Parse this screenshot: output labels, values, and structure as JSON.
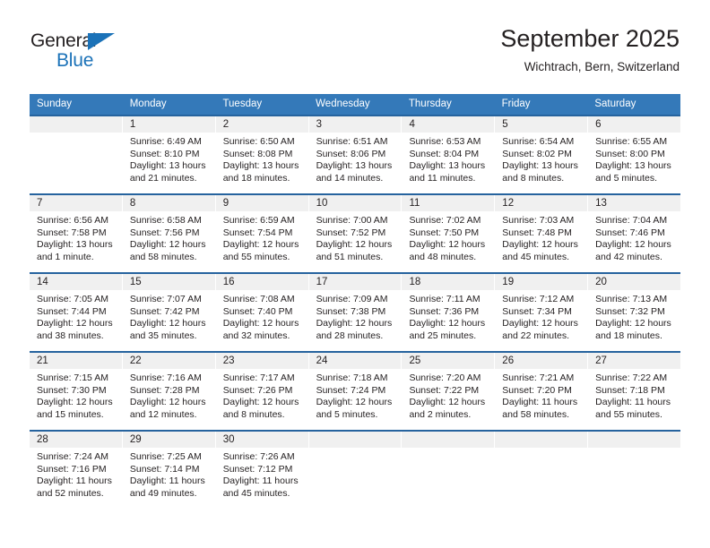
{
  "logo": {
    "word_top": "General",
    "word_bottom": "Blue",
    "triangle_color": "#1b72b8",
    "icon": "triangle-icon"
  },
  "header": {
    "title": "September 2025",
    "subtitle": "Wichtrach, Bern, Switzerland"
  },
  "theme": {
    "header_row_bg": "#3479b9",
    "week_divider": "#26639e",
    "daynum_band_bg": "#f0f0f0",
    "text": "#231f20"
  },
  "calendar": {
    "weekdays": [
      "Sunday",
      "Monday",
      "Tuesday",
      "Wednesday",
      "Thursday",
      "Friday",
      "Saturday"
    ],
    "weeks": [
      [
        {
          "day": "",
          "empty": true,
          "sunrise": "",
          "sunset": "",
          "daylight_line1": "",
          "daylight_line2": ""
        },
        {
          "day": "1",
          "sunrise": "Sunrise: 6:49 AM",
          "sunset": "Sunset: 8:10 PM",
          "daylight_line1": "Daylight: 13 hours",
          "daylight_line2": "and 21 minutes."
        },
        {
          "day": "2",
          "sunrise": "Sunrise: 6:50 AM",
          "sunset": "Sunset: 8:08 PM",
          "daylight_line1": "Daylight: 13 hours",
          "daylight_line2": "and 18 minutes."
        },
        {
          "day": "3",
          "sunrise": "Sunrise: 6:51 AM",
          "sunset": "Sunset: 8:06 PM",
          "daylight_line1": "Daylight: 13 hours",
          "daylight_line2": "and 14 minutes."
        },
        {
          "day": "4",
          "sunrise": "Sunrise: 6:53 AM",
          "sunset": "Sunset: 8:04 PM",
          "daylight_line1": "Daylight: 13 hours",
          "daylight_line2": "and 11 minutes."
        },
        {
          "day": "5",
          "sunrise": "Sunrise: 6:54 AM",
          "sunset": "Sunset: 8:02 PM",
          "daylight_line1": "Daylight: 13 hours",
          "daylight_line2": "and 8 minutes."
        },
        {
          "day": "6",
          "sunrise": "Sunrise: 6:55 AM",
          "sunset": "Sunset: 8:00 PM",
          "daylight_line1": "Daylight: 13 hours",
          "daylight_line2": "and 5 minutes."
        }
      ],
      [
        {
          "day": "7",
          "sunrise": "Sunrise: 6:56 AM",
          "sunset": "Sunset: 7:58 PM",
          "daylight_line1": "Daylight: 13 hours",
          "daylight_line2": "and 1 minute."
        },
        {
          "day": "8",
          "sunrise": "Sunrise: 6:58 AM",
          "sunset": "Sunset: 7:56 PM",
          "daylight_line1": "Daylight: 12 hours",
          "daylight_line2": "and 58 minutes."
        },
        {
          "day": "9",
          "sunrise": "Sunrise: 6:59 AM",
          "sunset": "Sunset: 7:54 PM",
          "daylight_line1": "Daylight: 12 hours",
          "daylight_line2": "and 55 minutes."
        },
        {
          "day": "10",
          "sunrise": "Sunrise: 7:00 AM",
          "sunset": "Sunset: 7:52 PM",
          "daylight_line1": "Daylight: 12 hours",
          "daylight_line2": "and 51 minutes."
        },
        {
          "day": "11",
          "sunrise": "Sunrise: 7:02 AM",
          "sunset": "Sunset: 7:50 PM",
          "daylight_line1": "Daylight: 12 hours",
          "daylight_line2": "and 48 minutes."
        },
        {
          "day": "12",
          "sunrise": "Sunrise: 7:03 AM",
          "sunset": "Sunset: 7:48 PM",
          "daylight_line1": "Daylight: 12 hours",
          "daylight_line2": "and 45 minutes."
        },
        {
          "day": "13",
          "sunrise": "Sunrise: 7:04 AM",
          "sunset": "Sunset: 7:46 PM",
          "daylight_line1": "Daylight: 12 hours",
          "daylight_line2": "and 42 minutes."
        }
      ],
      [
        {
          "day": "14",
          "sunrise": "Sunrise: 7:05 AM",
          "sunset": "Sunset: 7:44 PM",
          "daylight_line1": "Daylight: 12 hours",
          "daylight_line2": "and 38 minutes."
        },
        {
          "day": "15",
          "sunrise": "Sunrise: 7:07 AM",
          "sunset": "Sunset: 7:42 PM",
          "daylight_line1": "Daylight: 12 hours",
          "daylight_line2": "and 35 minutes."
        },
        {
          "day": "16",
          "sunrise": "Sunrise: 7:08 AM",
          "sunset": "Sunset: 7:40 PM",
          "daylight_line1": "Daylight: 12 hours",
          "daylight_line2": "and 32 minutes."
        },
        {
          "day": "17",
          "sunrise": "Sunrise: 7:09 AM",
          "sunset": "Sunset: 7:38 PM",
          "daylight_line1": "Daylight: 12 hours",
          "daylight_line2": "and 28 minutes."
        },
        {
          "day": "18",
          "sunrise": "Sunrise: 7:11 AM",
          "sunset": "Sunset: 7:36 PM",
          "daylight_line1": "Daylight: 12 hours",
          "daylight_line2": "and 25 minutes."
        },
        {
          "day": "19",
          "sunrise": "Sunrise: 7:12 AM",
          "sunset": "Sunset: 7:34 PM",
          "daylight_line1": "Daylight: 12 hours",
          "daylight_line2": "and 22 minutes."
        },
        {
          "day": "20",
          "sunrise": "Sunrise: 7:13 AM",
          "sunset": "Sunset: 7:32 PM",
          "daylight_line1": "Daylight: 12 hours",
          "daylight_line2": "and 18 minutes."
        }
      ],
      [
        {
          "day": "21",
          "sunrise": "Sunrise: 7:15 AM",
          "sunset": "Sunset: 7:30 PM",
          "daylight_line1": "Daylight: 12 hours",
          "daylight_line2": "and 15 minutes."
        },
        {
          "day": "22",
          "sunrise": "Sunrise: 7:16 AM",
          "sunset": "Sunset: 7:28 PM",
          "daylight_line1": "Daylight: 12 hours",
          "daylight_line2": "and 12 minutes."
        },
        {
          "day": "23",
          "sunrise": "Sunrise: 7:17 AM",
          "sunset": "Sunset: 7:26 PM",
          "daylight_line1": "Daylight: 12 hours",
          "daylight_line2": "and 8 minutes."
        },
        {
          "day": "24",
          "sunrise": "Sunrise: 7:18 AM",
          "sunset": "Sunset: 7:24 PM",
          "daylight_line1": "Daylight: 12 hours",
          "daylight_line2": "and 5 minutes."
        },
        {
          "day": "25",
          "sunrise": "Sunrise: 7:20 AM",
          "sunset": "Sunset: 7:22 PM",
          "daylight_line1": "Daylight: 12 hours",
          "daylight_line2": "and 2 minutes."
        },
        {
          "day": "26",
          "sunrise": "Sunrise: 7:21 AM",
          "sunset": "Sunset: 7:20 PM",
          "daylight_line1": "Daylight: 11 hours",
          "daylight_line2": "and 58 minutes."
        },
        {
          "day": "27",
          "sunrise": "Sunrise: 7:22 AM",
          "sunset": "Sunset: 7:18 PM",
          "daylight_line1": "Daylight: 11 hours",
          "daylight_line2": "and 55 minutes."
        }
      ],
      [
        {
          "day": "28",
          "sunrise": "Sunrise: 7:24 AM",
          "sunset": "Sunset: 7:16 PM",
          "daylight_line1": "Daylight: 11 hours",
          "daylight_line2": "and 52 minutes."
        },
        {
          "day": "29",
          "sunrise": "Sunrise: 7:25 AM",
          "sunset": "Sunset: 7:14 PM",
          "daylight_line1": "Daylight: 11 hours",
          "daylight_line2": "and 49 minutes."
        },
        {
          "day": "30",
          "sunrise": "Sunrise: 7:26 AM",
          "sunset": "Sunset: 7:12 PM",
          "daylight_line1": "Daylight: 11 hours",
          "daylight_line2": "and 45 minutes."
        },
        {
          "day": "",
          "empty": true,
          "sunrise": "",
          "sunset": "",
          "daylight_line1": "",
          "daylight_line2": ""
        },
        {
          "day": "",
          "empty": true,
          "sunrise": "",
          "sunset": "",
          "daylight_line1": "",
          "daylight_line2": ""
        },
        {
          "day": "",
          "empty": true,
          "sunrise": "",
          "sunset": "",
          "daylight_line1": "",
          "daylight_line2": ""
        },
        {
          "day": "",
          "empty": true,
          "sunrise": "",
          "sunset": "",
          "daylight_line1": "",
          "daylight_line2": ""
        }
      ]
    ]
  }
}
